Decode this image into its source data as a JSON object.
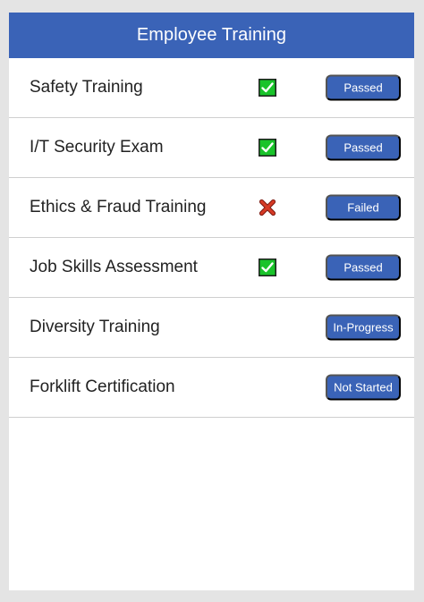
{
  "app": {
    "title": "Employee Training"
  },
  "colors": {
    "header_bg": "#3a63b7",
    "badge_bg": "#3a63b7",
    "check_green": "#19c32a",
    "cross_red": "#d63a25"
  },
  "trainings": [
    {
      "name": "Safety Training",
      "status": "Passed",
      "icon": "check-icon"
    },
    {
      "name": "I/T Security Exam",
      "status": "Passed",
      "icon": "check-icon"
    },
    {
      "name": "Ethics & Fraud Training",
      "status": "Failed",
      "icon": "cross-icon"
    },
    {
      "name": "Job Skills Assessment",
      "status": "Passed",
      "icon": "check-icon"
    },
    {
      "name": "Diversity Training",
      "status": "In-Progress",
      "icon": ""
    },
    {
      "name": "Forklift Certification",
      "status": "Not Started",
      "icon": ""
    }
  ]
}
